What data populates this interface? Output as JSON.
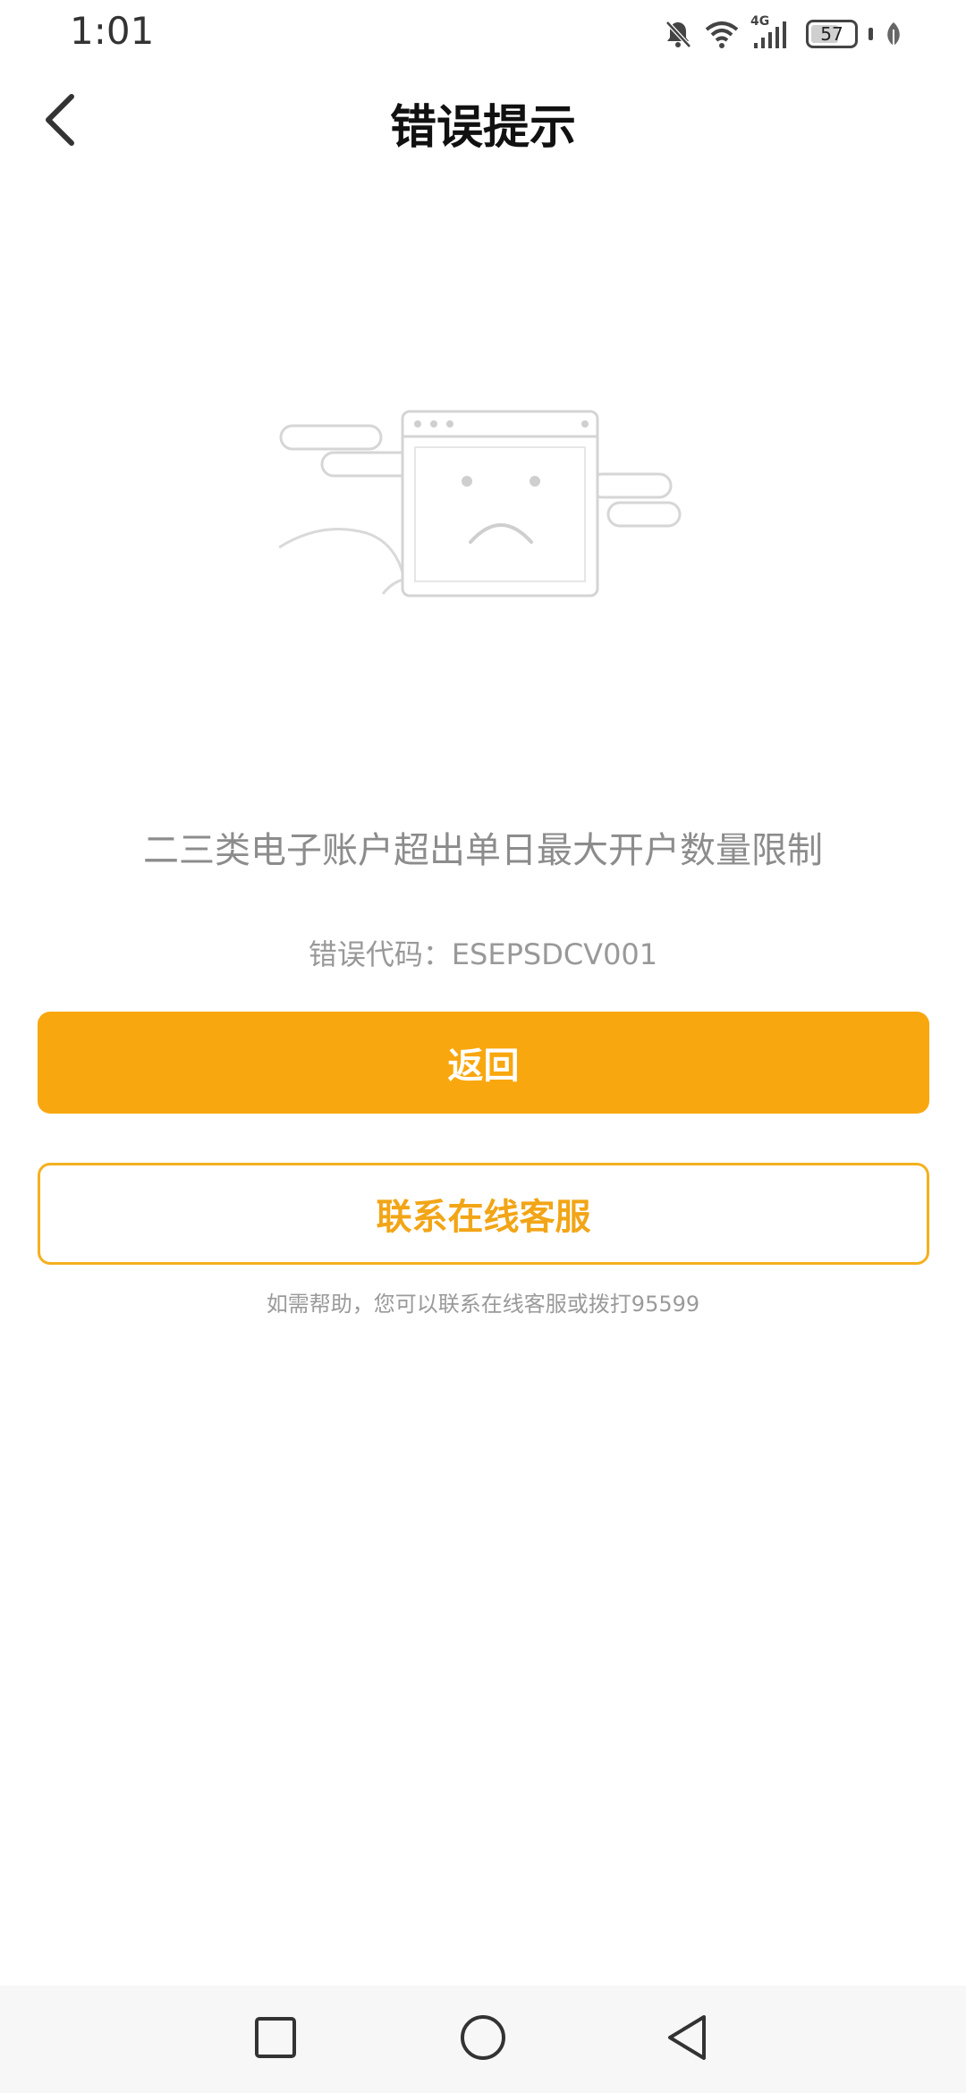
{
  "status_bar": {
    "time": "1:01",
    "network": "4G",
    "battery": "57",
    "icons": [
      "mute-bell-icon",
      "wifi-icon",
      "cellular-signal-icon",
      "battery-icon",
      "leaf-icon"
    ]
  },
  "header": {
    "title": "错误提示",
    "back_icon": "chevron-left-icon"
  },
  "illustration": {
    "icon": "sad-browser-window-illustration"
  },
  "error": {
    "message": "二三类电子账户超出单日最大开户数量限制",
    "code": "错误代码：ESEPSDCV001"
  },
  "actions": {
    "primary_label": "返回",
    "secondary_label": "联系在线客服"
  },
  "help_text": "如需帮助，您可以联系在线客服或拨打95599",
  "nav_bar": {
    "icons": [
      "recent-apps-icon",
      "home-icon",
      "back-icon"
    ]
  },
  "colors": {
    "accent": "#f9a70f",
    "outline": "#f5b01f",
    "muted_text": "#8c8c8c"
  }
}
